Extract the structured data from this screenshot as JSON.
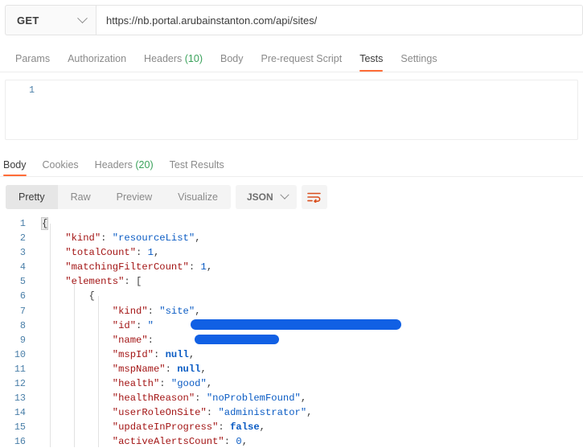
{
  "request": {
    "method": "GET",
    "url": "https://nb.portal.arubainstanton.com/api/sites/",
    "tabs": [
      {
        "label": "Params",
        "active": false
      },
      {
        "label": "Authorization",
        "active": false
      },
      {
        "label": "Headers",
        "count": "(10)",
        "active": false
      },
      {
        "label": "Body",
        "active": false
      },
      {
        "label": "Pre-request Script",
        "active": false
      },
      {
        "label": "Tests",
        "active": true
      },
      {
        "label": "Settings",
        "active": false
      }
    ],
    "script_editor": {
      "line_number": "1",
      "content": ""
    }
  },
  "response": {
    "tabs": [
      {
        "label": "Body",
        "active": true
      },
      {
        "label": "Cookies",
        "active": false
      },
      {
        "label": "Headers",
        "count": "(20)",
        "active": false
      },
      {
        "label": "Test Results",
        "active": false
      }
    ],
    "format_modes": [
      {
        "label": "Pretty",
        "active": true
      },
      {
        "label": "Raw",
        "active": false
      },
      {
        "label": "Preview",
        "active": false
      },
      {
        "label": "Visualize",
        "active": false
      }
    ],
    "language": "JSON",
    "wrap_icon": "word-wrap-icon",
    "body_lines": [
      {
        "n": "1",
        "tokens": [
          {
            "t": "brace",
            "v": "{"
          }
        ]
      },
      {
        "n": "2",
        "tokens": [
          {
            "t": "p",
            "v": "    "
          },
          {
            "t": "k",
            "v": "\"kind\""
          },
          {
            "t": "p",
            "v": ": "
          },
          {
            "t": "s",
            "v": "\"resourceList\""
          },
          {
            "t": "p",
            "v": ","
          }
        ]
      },
      {
        "n": "3",
        "tokens": [
          {
            "t": "p",
            "v": "    "
          },
          {
            "t": "k",
            "v": "\"totalCount\""
          },
          {
            "t": "p",
            "v": ": "
          },
          {
            "t": "n",
            "v": "1"
          },
          {
            "t": "p",
            "v": ","
          }
        ]
      },
      {
        "n": "4",
        "tokens": [
          {
            "t": "p",
            "v": "    "
          },
          {
            "t": "k",
            "v": "\"matchingFilterCount\""
          },
          {
            "t": "p",
            "v": ": "
          },
          {
            "t": "n",
            "v": "1"
          },
          {
            "t": "p",
            "v": ","
          }
        ]
      },
      {
        "n": "5",
        "tokens": [
          {
            "t": "p",
            "v": "    "
          },
          {
            "t": "k",
            "v": "\"elements\""
          },
          {
            "t": "p",
            "v": ": ["
          }
        ]
      },
      {
        "n": "6",
        "tokens": [
          {
            "t": "p",
            "v": "        {"
          }
        ]
      },
      {
        "n": "7",
        "tokens": [
          {
            "t": "p",
            "v": "            "
          },
          {
            "t": "k",
            "v": "\"kind\""
          },
          {
            "t": "p",
            "v": ": "
          },
          {
            "t": "s",
            "v": "\"site\""
          },
          {
            "t": "p",
            "v": ","
          }
        ]
      },
      {
        "n": "8",
        "redacted": "id",
        "tokens": [
          {
            "t": "p",
            "v": "            "
          },
          {
            "t": "k",
            "v": "\"id\""
          },
          {
            "t": "p",
            "v": ": "
          },
          {
            "t": "s",
            "v": "\""
          },
          {
            "t": "p",
            "v": "                                  "
          },
          {
            "t": "s",
            "v": "\""
          },
          {
            "t": "p",
            "v": ","
          }
        ]
      },
      {
        "n": "9",
        "redacted": "name",
        "tokens": [
          {
            "t": "p",
            "v": "            "
          },
          {
            "t": "k",
            "v": "\"name\""
          },
          {
            "t": "p",
            "v": ": "
          },
          {
            "t": "p",
            "v": "             "
          },
          {
            "t": "p",
            "v": ","
          }
        ]
      },
      {
        "n": "10",
        "tokens": [
          {
            "t": "p",
            "v": "            "
          },
          {
            "t": "k",
            "v": "\"mspId\""
          },
          {
            "t": "p",
            "v": ": "
          },
          {
            "t": "kw",
            "v": "null"
          },
          {
            "t": "p",
            "v": ","
          }
        ]
      },
      {
        "n": "11",
        "tokens": [
          {
            "t": "p",
            "v": "            "
          },
          {
            "t": "k",
            "v": "\"mspName\""
          },
          {
            "t": "p",
            "v": ": "
          },
          {
            "t": "kw",
            "v": "null"
          },
          {
            "t": "p",
            "v": ","
          }
        ]
      },
      {
        "n": "12",
        "tokens": [
          {
            "t": "p",
            "v": "            "
          },
          {
            "t": "k",
            "v": "\"health\""
          },
          {
            "t": "p",
            "v": ": "
          },
          {
            "t": "s",
            "v": "\"good\""
          },
          {
            "t": "p",
            "v": ","
          }
        ]
      },
      {
        "n": "13",
        "tokens": [
          {
            "t": "p",
            "v": "            "
          },
          {
            "t": "k",
            "v": "\"healthReason\""
          },
          {
            "t": "p",
            "v": ": "
          },
          {
            "t": "s",
            "v": "\"noProblemFound\""
          },
          {
            "t": "p",
            "v": ","
          }
        ]
      },
      {
        "n": "14",
        "tokens": [
          {
            "t": "p",
            "v": "            "
          },
          {
            "t": "k",
            "v": "\"userRoleOnSite\""
          },
          {
            "t": "p",
            "v": ": "
          },
          {
            "t": "s",
            "v": "\"administrator\""
          },
          {
            "t": "p",
            "v": ","
          }
        ]
      },
      {
        "n": "15",
        "tokens": [
          {
            "t": "p",
            "v": "            "
          },
          {
            "t": "k",
            "v": "\"updateInProgress\""
          },
          {
            "t": "p",
            "v": ": "
          },
          {
            "t": "kw",
            "v": "false"
          },
          {
            "t": "p",
            "v": ","
          }
        ]
      },
      {
        "n": "16",
        "tokens": [
          {
            "t": "p",
            "v": "            "
          },
          {
            "t": "k",
            "v": "\"activeAlertsCount\""
          },
          {
            "t": "p",
            "v": ": "
          },
          {
            "t": "n",
            "v": "0"
          },
          {
            "t": "p",
            "v": ","
          }
        ]
      }
    ]
  },
  "colors": {
    "accent": "#ff6c37",
    "redaction": "#1160e4",
    "json_key": "#a31515",
    "json_string": "#0b5cc4",
    "count_green": "#3aa25b",
    "line_number": "#4a7fa8"
  }
}
